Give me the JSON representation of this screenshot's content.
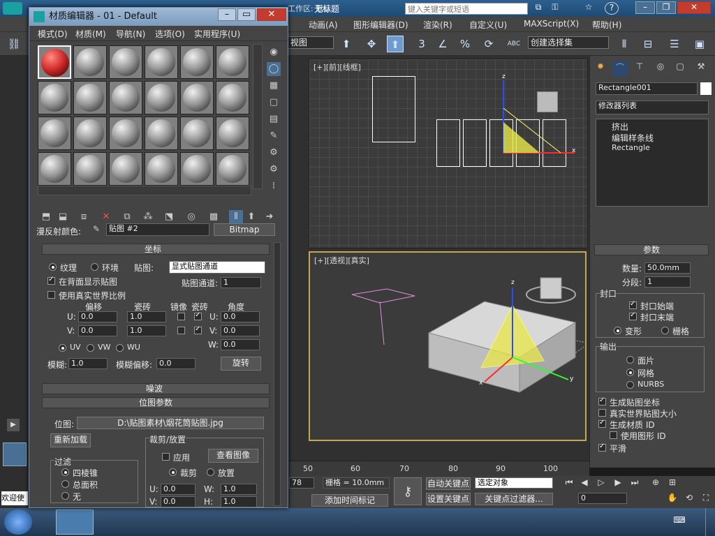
{
  "app": {
    "title": "无标题",
    "search_placeholder": "键入关键字或短语",
    "workspace_label": "工作区: 默认"
  },
  "menu": [
    "动画(A)",
    "图形编辑器(D)",
    "渲染(R)",
    "自定义(U)",
    "MAXScript(X)",
    "帮助(H)"
  ],
  "toolbar": {
    "viewport_select": "视图",
    "selection_set": "创建选择集",
    "snap_3": "3",
    "percent": "%",
    "abc": "ABC"
  },
  "viewports": {
    "top_label": "[+][前][线框]",
    "persp_label": "[+][透视][真实]",
    "timeline_ticks": [
      "50",
      "60",
      "70",
      "80",
      "90",
      "100"
    ],
    "axis_z": "z",
    "axis_x": "x",
    "axis_y": "y"
  },
  "command_panel": {
    "object_name": "Rectangle001",
    "modifier_list": "修改器列表",
    "stack": [
      "挤出",
      "编辑样条线",
      "Rectangle"
    ],
    "params_header": "参数",
    "amount_label": "数量:",
    "amount_value": "50.0mm",
    "segments_label": "分段:",
    "segments_value": "1",
    "capping_label": "封口",
    "cap_start": "封口始端",
    "cap_end": "封口末端",
    "morph": "变形",
    "grid": "栅格",
    "output_label": "输出",
    "out_patch": "面片",
    "out_mesh": "网格",
    "out_nurbs": "NURBS",
    "gen_mapping": "生成贴图坐标",
    "real_world": "真实世界贴图大小",
    "gen_matid": "生成材质 ID",
    "use_shape_id": "使用图形 ID",
    "smooth": "平滑"
  },
  "status": {
    "frame_field": "78",
    "grid_label": "栅格 = 10.0mm",
    "auto_key": "自动关键点",
    "selected_obj": "选定对象",
    "set_key": "设置关键点",
    "key_filters": "关键点过滤器...",
    "add_time_tag": "添加时间标记",
    "frame_value": "0",
    "welcome": "欢迎使"
  },
  "material_editor": {
    "title": "材质编辑器 - 01 - Default",
    "menu": [
      "模式(D)",
      "材质(M)",
      "导航(N)",
      "选项(O)",
      "实用程序(U)"
    ],
    "diffuse_label": "漫反射颜色:",
    "map_name": "贴图 #2",
    "map_type": "Bitmap",
    "coords_header": "坐标",
    "texture": "纹理",
    "environ": "环境",
    "mapping_label": "贴图:",
    "mapping_value": "显式贴图通道",
    "show_back": "在背面显示贴图",
    "map_channel_label": "贴图通道:",
    "map_channel_value": "1",
    "use_real_world": "使用真实世界比例",
    "offset": "偏移",
    "tiling": "瓷砖",
    "mirror": "镜像",
    "tile": "瓷砖",
    "angle": "角度",
    "u_label": "U:",
    "v_label": "V:",
    "w_label": "W:",
    "u_offset": "0.0",
    "v_offset": "0.0",
    "u_tiling": "1.0",
    "v_tiling": "1.0",
    "u_angle": "0.0",
    "v_angle": "0.0",
    "w_angle": "0.0",
    "uv": "UV",
    "vw": "VW",
    "wu": "WU",
    "blur_label": "模糊:",
    "blur_value": "1.0",
    "blur_offset_label": "模糊偏移:",
    "blur_offset_value": "0.0",
    "rotate_btn": "旋转",
    "noise_header": "噪波",
    "bitmap_params_header": "位图参数",
    "bitmap_label": "位图:",
    "bitmap_path": "D:\\贴图素材\\烟花筒贴图.jpg",
    "reload_btn": "重新加载",
    "crop_place": "裁剪/放置",
    "apply": "应用",
    "view_image": "查看图像",
    "crop": "裁剪",
    "place": "放置",
    "filter_label": "过滤",
    "pyramidal": "四棱锥",
    "summed_area": "总面积",
    "none": "无",
    "crop_u_label": "U:",
    "crop_v_label": "V:",
    "crop_w_label": "W:",
    "crop_h_label": "H:",
    "crop_u": "0.0",
    "crop_v": "0.0",
    "crop_w": "1.0",
    "crop_h": "1.0"
  }
}
